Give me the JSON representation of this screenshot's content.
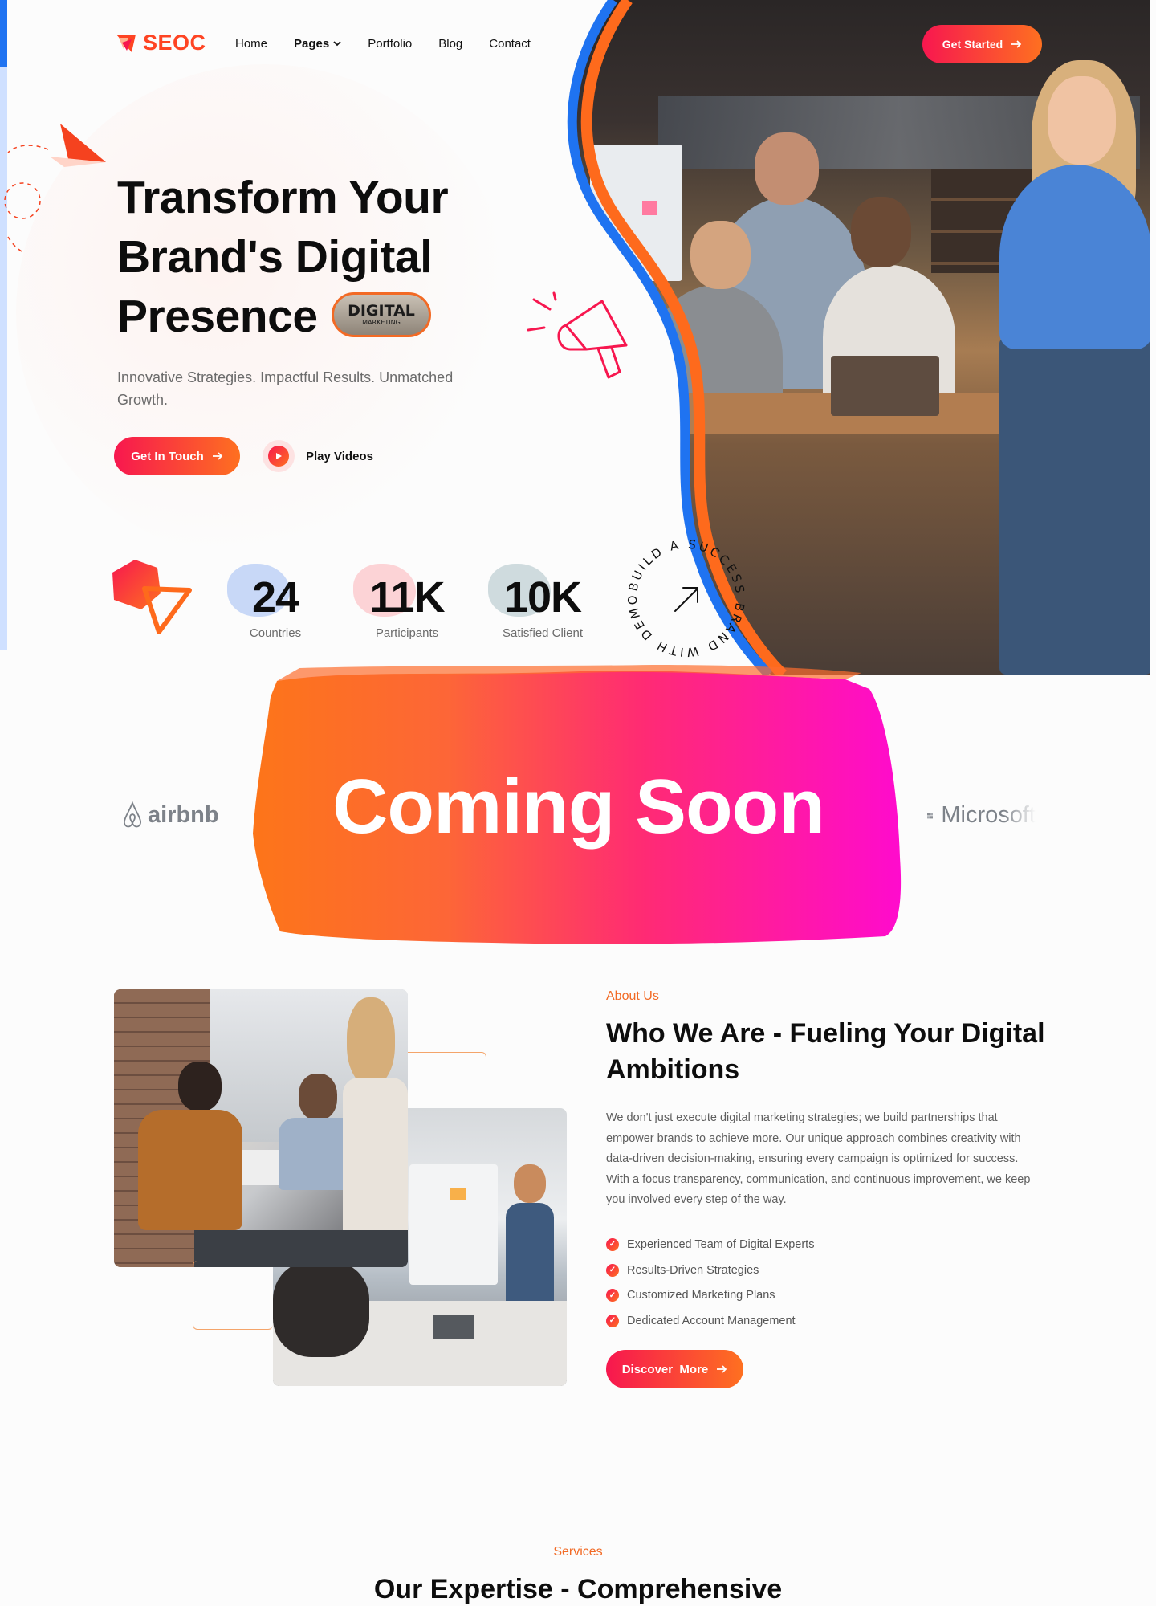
{
  "brand": {
    "name": "SEOC",
    "accent": "#fe4423",
    "gradient_start": "#f7174f",
    "gradient_end": "#fe7020",
    "blue": "#1f73f1"
  },
  "nav": {
    "items": [
      {
        "label": "Home",
        "active": false
      },
      {
        "label": "Pages",
        "active": true,
        "has_dropdown": true
      },
      {
        "label": "Portfolio",
        "active": false
      },
      {
        "label": "Blog",
        "active": false
      },
      {
        "label": "Contact",
        "active": false
      }
    ],
    "cta": "Get Started"
  },
  "hero": {
    "title_lines": [
      "Transform Your",
      "Brand's Digital",
      "Presence"
    ],
    "badge_main": "DIGITAL",
    "badge_sub": "MARKETING",
    "subtitle": "Innovative Strategies. Impactful Results. Unmatched Growth.",
    "primary_button": "Get In Touch",
    "play_label": "Play Videos"
  },
  "stats": [
    {
      "value": "24",
      "label": "Countries",
      "blob_color": "#c8d8f7"
    },
    {
      "value": "11K",
      "label": "Participants",
      "blob_color": "#fcd3d6"
    },
    {
      "value": "10K",
      "label": "Satisfied Client",
      "blob_color": "#cfdbde"
    }
  ],
  "ring_badge": {
    "text": "BUILD A SUCCESS BRAND WITH DEMOUI",
    "icon": "arrow-up-right-icon"
  },
  "coming_soon": {
    "text": "Coming Soon",
    "logos": [
      "airbnb",
      "Microsoft"
    ]
  },
  "about": {
    "eyebrow": "About Us",
    "title": "Who We Are - Fueling Your Digital Ambitions",
    "text": "We don't just execute digital marketing strategies; we build partnerships that empower brands to achieve more. Our unique approach combines creativity with data-driven decision-making, ensuring every campaign is optimized for success. With a focus transparency, communication, and continuous improvement, we keep you involved every step of the way.",
    "checks": [
      "Experienced Team of Digital Experts",
      "Results-Driven Strategies",
      "Customized Marketing Plans",
      "Dedicated Account Management"
    ],
    "button": "Discover  More"
  },
  "services": {
    "eyebrow": "Services",
    "title": "Our Expertise - Comprehensive"
  }
}
